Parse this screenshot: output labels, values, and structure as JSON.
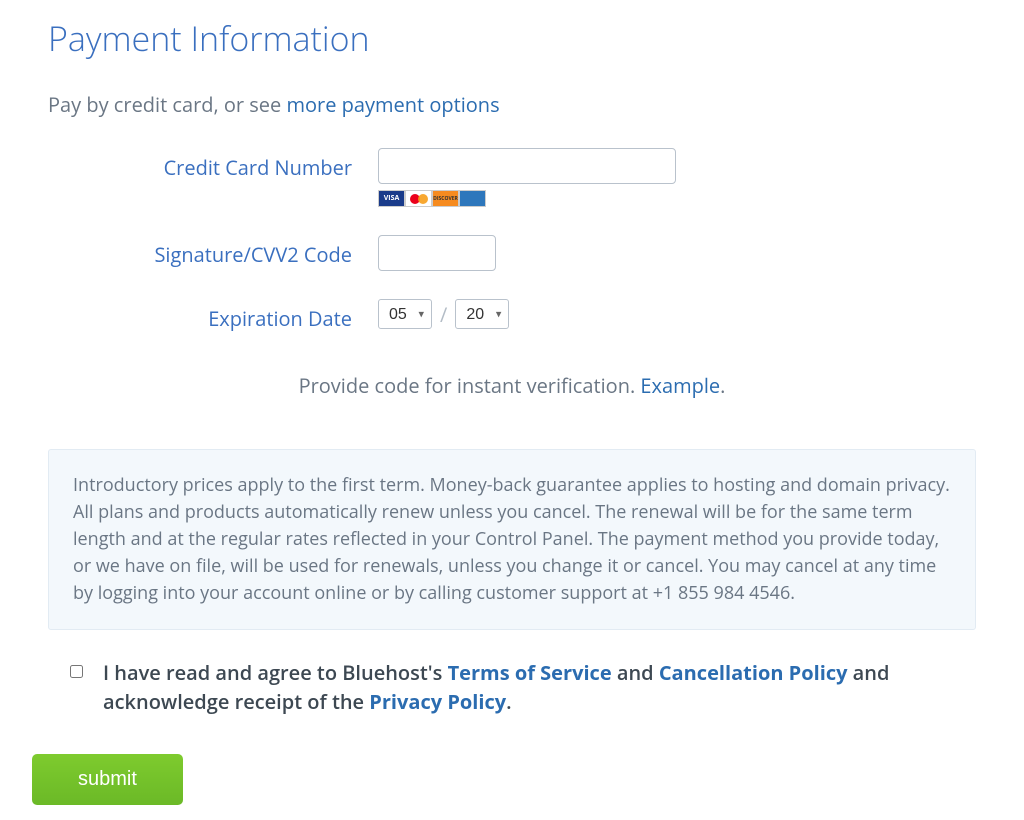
{
  "title": "Payment Information",
  "intro": {
    "prefix": "Pay by credit card, or see ",
    "link": "more payment options"
  },
  "fields": {
    "card_number": {
      "label": "Credit Card Number",
      "value": ""
    },
    "cvv": {
      "label": "Signature/CVV2 Code",
      "value": ""
    },
    "expiration": {
      "label": "Expiration Date",
      "month_value": "05",
      "year_value": "20",
      "month_options": [
        "05"
      ],
      "year_options": [
        "20"
      ]
    }
  },
  "card_brands": [
    "visa",
    "mastercard",
    "discover",
    "amex"
  ],
  "verify": {
    "prefix": "Provide code for instant verification. ",
    "link": "Example",
    "suffix": "."
  },
  "terms_box": "Introductory prices apply to the first term. Money-back guarantee applies to hosting and domain privacy. All plans and products automatically renew unless you cancel. The renewal will be for the same term length and at the regular rates reflected in your Control Panel. The payment method you provide today, or we have on file, will be used for renewals, unless you change it or cancel. You may cancel at any time by logging into your account online or by calling customer support at +1 855 984 4546.",
  "agree": {
    "checked": false,
    "p1": "I have read and agree to Bluehost's ",
    "tos": "Terms of Service",
    "p2": " and ",
    "cancel": "Cancellation Policy",
    "p3": " and acknowledge receipt of the ",
    "privacy": "Privacy Policy",
    "p4": "."
  },
  "submit_label": "submit"
}
